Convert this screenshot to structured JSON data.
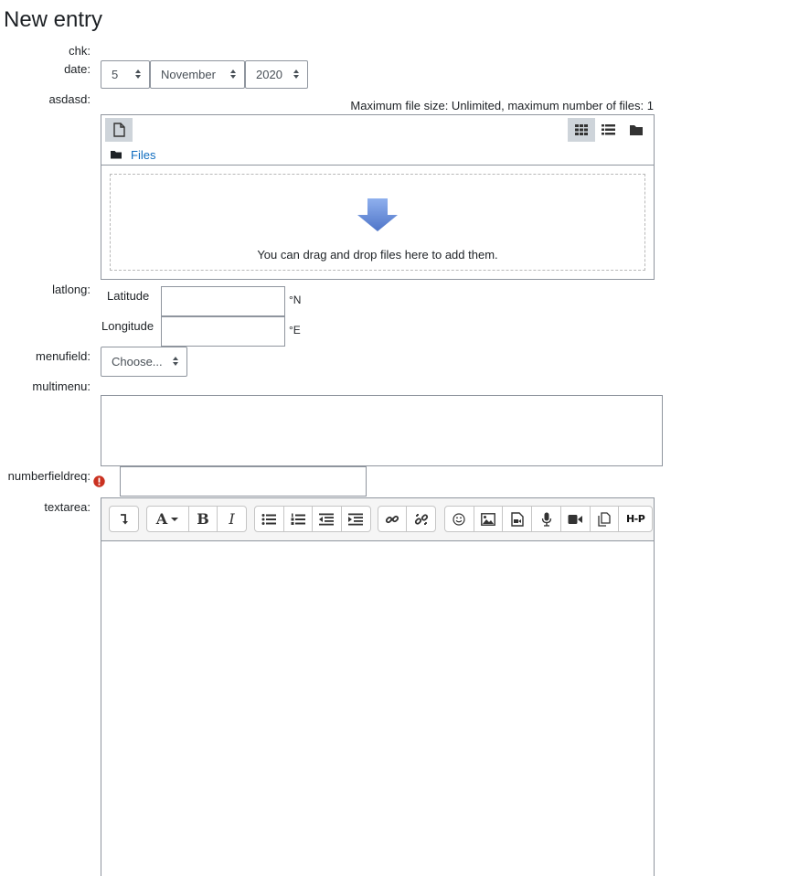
{
  "page": {
    "title": "New entry"
  },
  "fields": {
    "chk": {
      "label": "chk:"
    },
    "date": {
      "label": "date:",
      "day": "5",
      "month": "November",
      "year": "2020"
    },
    "file": {
      "label": "asdasd:",
      "limits": "Maximum file size: Unlimited, maximum number of files: 1",
      "folder": "Files",
      "dropzone_text": "You can drag and drop files here to add them."
    },
    "latlong": {
      "label": "latlong:",
      "latitude_label": "Latitude",
      "longitude_label": "Longitude",
      "n_unit": "°N",
      "e_unit": "°E"
    },
    "menufield": {
      "label": "menufield:",
      "value": "Choose..."
    },
    "multimenu": {
      "label": "multimenu:"
    },
    "numberfieldreq": {
      "label": "numberfieldreq:",
      "required_icon": "exclamation-circle-icon"
    },
    "textarea": {
      "label": "textarea:"
    }
  },
  "editor_toolbar": {
    "icons": [
      "collapse-icon",
      "font-style-icon",
      "bold-icon",
      "italic-icon",
      "unordered-list-icon",
      "ordered-list-icon",
      "outdent-icon",
      "indent-icon",
      "link-icon",
      "unlink-icon",
      "emoticon-icon",
      "image-icon",
      "media-icon",
      "record-audio-icon",
      "record-video-icon",
      "manage-files-icon",
      "h5p-icon"
    ],
    "bold": "B",
    "italic": "I",
    "font": "A",
    "h5p": "H-P"
  },
  "colors": {
    "link": "#0f6cbf",
    "required": "#ca3120",
    "arrow": "#6a8fd8"
  }
}
